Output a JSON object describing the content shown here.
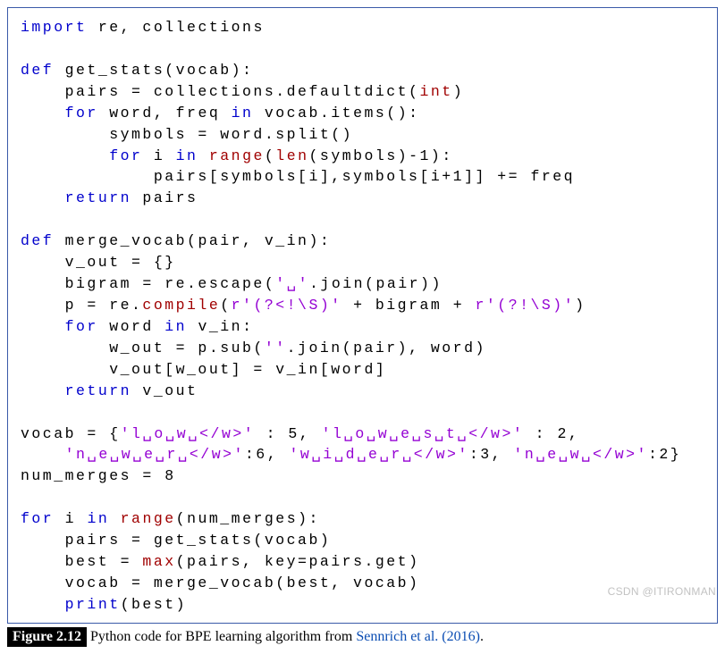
{
  "code": {
    "l1a": "import",
    "l1b": " re, collections",
    "l2": "",
    "l3a": "def",
    "l3b": " get_stats(vocab):",
    "l4": "    pairs = collections.defaultdict(",
    "l4b": "int",
    "l4c": ")",
    "l5a": "    ",
    "l5b": "for",
    "l5c": " word, freq ",
    "l5d": "in",
    "l5e": " vocab.items():",
    "l6": "        symbols = word.split()",
    "l7a": "        ",
    "l7b": "for",
    "l7c": " i ",
    "l7d": "in",
    "l7e": " ",
    "l7f": "range",
    "l7g": "(",
    "l7h": "len",
    "l7i": "(symbols)-1):",
    "l8": "            pairs[symbols[i],symbols[i+1]] += freq",
    "l9a": "    ",
    "l9b": "return",
    "l9c": " pairs",
    "l10": "",
    "l11a": "def",
    "l11b": " merge_vocab(pair, v_in):",
    "l12": "    v_out = {}",
    "l13a": "    bigram = re.escape(",
    "l13b": "'␣'",
    "l13c": ".join(pair))",
    "l14a": "    p = re.",
    "l14b": "compile",
    "l14c": "(",
    "l14d": "r'(?<!\\S)'",
    "l14e": " + bigram + ",
    "l14f": "r'(?!\\S)'",
    "l14g": ")",
    "l15a": "    ",
    "l15b": "for",
    "l15c": " word ",
    "l15d": "in",
    "l15e": " v_in:",
    "l16a": "        w_out = p.sub(",
    "l16b": "''",
    "l16c": ".join(pair), word)",
    "l17": "        v_out[w_out] = v_in[word]",
    "l18a": "    ",
    "l18b": "return",
    "l18c": " v_out",
    "l19": "",
    "l20a": "vocab = {",
    "l20b": "'l␣o␣w␣</w>'",
    "l20c": " : 5, ",
    "l20d": "'l␣o␣w␣e␣s␣t␣</w>'",
    "l20e": " : 2,",
    "l21a": "    ",
    "l21b": "'n␣e␣w␣e␣r␣</w>'",
    "l21c": ":6, ",
    "l21d": "'w␣i␣d␣e␣r␣</w>'",
    "l21e": ":3, ",
    "l21f": "'n␣e␣w␣</w>'",
    "l21g": ":2}",
    "l22": "num_merges = 8",
    "l23": "",
    "l24a": "for",
    "l24b": " i ",
    "l24c": "in",
    "l24d": " ",
    "l24e": "range",
    "l24f": "(num_merges):",
    "l25": "    pairs = get_stats(vocab)",
    "l26a": "    best = ",
    "l26b": "max",
    "l26c": "(pairs, key=pairs.get)",
    "l27": "    vocab = merge_vocab(best, vocab)",
    "l28a": "    ",
    "l28b": "print",
    "l28c": "(best)"
  },
  "caption": {
    "label": "Figure 2.12",
    "text_before": "   Python code for BPE learning algorithm from ",
    "citation": "Sennrich et al. (2016)",
    "text_after": "."
  },
  "watermark": "CSDN @ITIRONMAN"
}
